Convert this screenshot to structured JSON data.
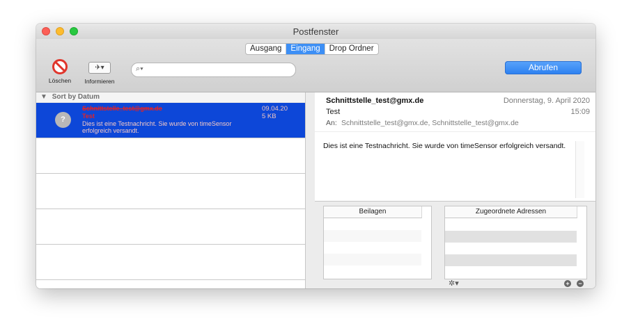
{
  "window": {
    "title": "Postfenster"
  },
  "tabs": [
    {
      "label": "Ausgang",
      "active": false
    },
    {
      "label": "Eingang",
      "active": true
    },
    {
      "label": "Drop Ordner",
      "active": false
    }
  ],
  "toolbar": {
    "delete_label": "Löschen",
    "info_label": "Informieren",
    "info_icon_glyph": "✈▾",
    "search_value": "",
    "fetch_label": "Abrufen"
  },
  "list": {
    "sort_label": "Sort by Datum",
    "sort_glyph": "▼",
    "messages": [
      {
        "icon_text": "?",
        "from": "Schnittstelle_test@gmx.de",
        "subject": "Test",
        "preview": "Dies ist eine Testnachricht. Sie wurde von timeSensor erfolgreich versandt.",
        "date": "09.04.20",
        "size": "5 KB"
      }
    ]
  },
  "detail": {
    "from": "Schnittstelle_test@gmx.de",
    "date": "Donnerstag, 9. April 2020",
    "subject": "Test",
    "time": "15:09",
    "to_label": "An:",
    "to": "Schnittstelle_test@gmx.de, Schnittstelle_test@gmx.de",
    "body": "Dies ist eine Testnachricht. Sie wurde von timeSensor erfolgreich versandt."
  },
  "attachments": {
    "header": "Beilagen"
  },
  "addresses": {
    "header": "Zugeordnete Adressen",
    "gear_glyph": "✲▾",
    "add_glyph": "+",
    "remove_glyph": "−"
  },
  "colors": {
    "accent": "#3d8ff5",
    "selection": "#0d47d8",
    "unread_text": "#e52323",
    "delete_red": "#e0362c"
  }
}
